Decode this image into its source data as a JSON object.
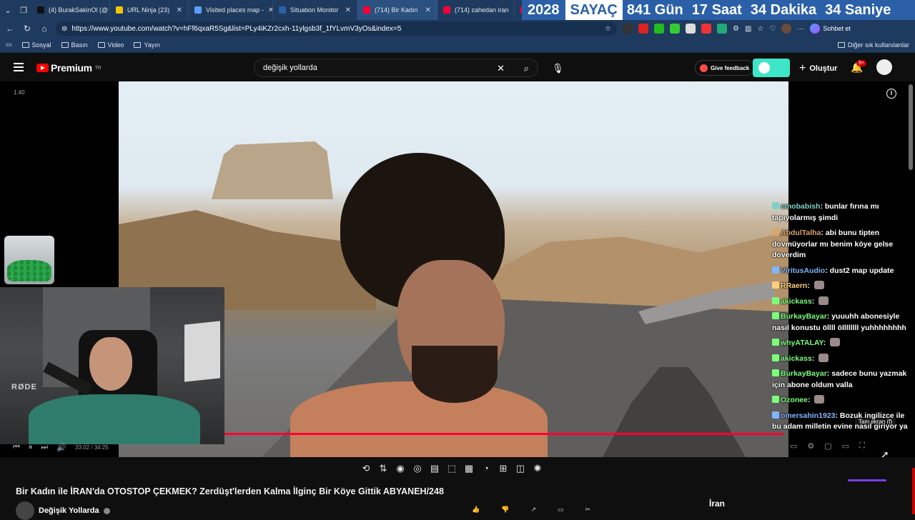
{
  "browser": {
    "tabs": [
      {
        "label": "(4) BurakSakinOl (@",
        "color": "#111111"
      },
      {
        "label": "URL Ninja (23)",
        "color": "#f5c400"
      },
      {
        "label": "Visited places map -",
        "color": "#5aa0ff"
      },
      {
        "label": "Situation Monitor",
        "color": "#2b60a8"
      },
      {
        "label": "(714) Bir Kadın",
        "color": "#ff0033",
        "active": true
      },
      {
        "label": "(714) zahedan iran",
        "color": "#ff0033"
      },
      {
        "label": "(7",
        "color": "#ff0033"
      }
    ],
    "url": "https://www.youtube.com/watch?v=hFf6qxaR5Sg&list=PLy4iKZr2cxh-11ylgsb3f_1fYLvmV3yOs&index=5",
    "chat_button": "Sohbet et",
    "bookmarks": [
      "Sosyal",
      "Basın",
      "Video",
      "Yayın"
    ],
    "other_bookmarks": "Diğer sık kullanılanlar"
  },
  "counter": {
    "year": "2028",
    "label": "SAYAÇ",
    "days": "841 Gün",
    "hours": "17 Saat",
    "minutes": "34 Dakika",
    "seconds": "34 Saniye"
  },
  "youtube": {
    "logo": "Premium",
    "region": "TR",
    "search_value": "değişik yollarda",
    "feedback": "Give feedback",
    "create": "Oluştur",
    "notif_count": "9+"
  },
  "player": {
    "rate": "1.40",
    "time": "33:02 / 34:25",
    "tooltip": "Tam ekran (f)",
    "progress": 0.96
  },
  "webcam": {
    "brand": "RØDE"
  },
  "chat": [
    {
      "user": "emobabish",
      "color": "#7fd1c8",
      "text": "bunlar fırına mı tapıyolarmış şimdi"
    },
    {
      "user": "AbdulTalha",
      "color": "#d9a66b",
      "text": "abi bunu tipten dovmüyorlar mı benim köye gelse doverdim"
    },
    {
      "user": "ViritusAudio",
      "color": "#7fb6ff",
      "text": "dust2 map update"
    },
    {
      "user": "RRaern",
      "color": "#ffd07a",
      "text": ""
    },
    {
      "user": "akickass",
      "color": "#7bff7b",
      "text": ""
    },
    {
      "user": "BurkayBayar",
      "color": "#7bff7b",
      "text": "yuuuhh abonesiyle nasıl konustu öllll öllllllll yuhhhhhhhh"
    },
    {
      "user": "whyATALAY",
      "color": "#7bff7b",
      "text": ""
    },
    {
      "user": "akickass",
      "color": "#7bff7b",
      "text": ""
    },
    {
      "user": "BurkayBayar",
      "color": "#7bff7b",
      "text": "sadece bunu yazmak için abone oldum valla"
    },
    {
      "user": "Ozonee",
      "color": "#7bff7b",
      "text": ""
    },
    {
      "user": "omersahin1923",
      "color": "#7fb6ff",
      "text": "Bozuk ingilizce ile bu adam milletin evine nasıl giriyor ya"
    }
  ],
  "video": {
    "title": "Bir Kadın ile İRAN'da OTOSTOP ÇEKMEK? Zerdüşt'lerden Kalma İlginç Bir Köye Gittik ABYANEH/248",
    "channel": "Değişik Yollarda"
  },
  "side_chip": "İran",
  "colors": {
    "accent_red": "#ff0033",
    "browser_bg": "#1f3a5f",
    "counter_bg": "#2b60a8"
  }
}
